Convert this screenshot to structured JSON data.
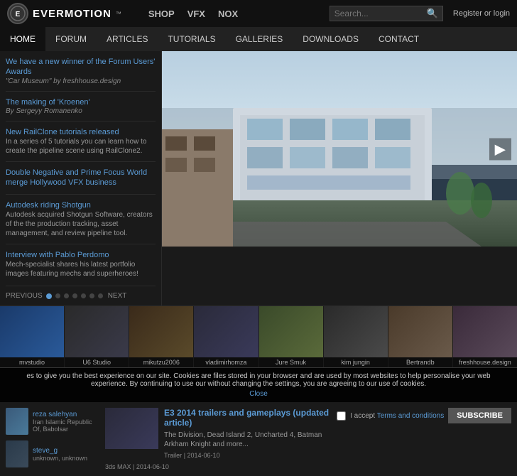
{
  "logo": {
    "icon": "E",
    "brand": "EVERMOTION",
    "tm": "™"
  },
  "topnav": {
    "items": [
      "SHOP",
      "VFX",
      "NOX"
    ],
    "search_placeholder": "Search...",
    "auth": "Register or login"
  },
  "mainnav": {
    "items": [
      "HOME",
      "FORUM",
      "ARTICLES",
      "TUTORIALS",
      "GALLERIES",
      "DOWNLOADS",
      "CONTACT"
    ],
    "active": "HOME"
  },
  "sidebar": {
    "news": [
      {
        "title": "We have a new winner of the Forum Users' Awards",
        "sub": "\"Car Museum\" by freshhouse.design",
        "desc": ""
      },
      {
        "title": "The making of 'Kroenen'",
        "sub": "By Sergeyy Romanenko",
        "desc": ""
      },
      {
        "title": "New RailClone tutorials released",
        "sub": "",
        "desc": "In a series of 5 tutorials you can learn how to create the pipeline scene using RailClone2."
      },
      {
        "title": "Double Negative and Prime Focus World merge Hollywood VFX business",
        "sub": "",
        "desc": ""
      },
      {
        "title": "Autodesk riding Shotgun",
        "sub": "",
        "desc": "Autodesk acquired Shotgun Software, creators of the the production tracking, asset management, and review pipeline tool."
      },
      {
        "title": "Interview with Pablo Perdomo",
        "sub": "",
        "desc": "Mech-specialist shares his latest portfolio images featuring mechs and superheroes!"
      }
    ],
    "prev": "PREVIOUS",
    "next": "NEXT",
    "dots": 7
  },
  "thumbs": [
    {
      "label": "mvstudio",
      "color": "t1"
    },
    {
      "label": "U6 Studio",
      "color": "t2"
    },
    {
      "label": "mikutzu2006",
      "color": "t3"
    },
    {
      "label": "vladimirhomza",
      "color": "t4"
    },
    {
      "label": "Jure Smuk",
      "color": "t5"
    },
    {
      "label": "kim jungin",
      "color": "t6"
    },
    {
      "label": "Bertrandb",
      "color": "t7"
    },
    {
      "label": "freshhouse.design",
      "color": "t8"
    }
  ],
  "cookie": {
    "text": "es to give you the best experience on our site. Cookies are files stored in your browser and are used by most websites to help personalise your web experience. By continuing to use our without changing the settings, you are agreeing to our use of cookies.",
    "close": "Close"
  },
  "bottom": {
    "users": [
      {
        "name": "reza salehyan",
        "loc": "Iran Islamic Republic Of, Babolsar"
      },
      {
        "name": "steve_g",
        "loc": "unknown, unknown"
      }
    ],
    "article": {
      "title": "E3 2014 trailers and gameplays (updated article)",
      "desc": "The Division, Dead Island 2, Uncharted 4, Batman Arkham Knight and more...",
      "tag": "Trailer",
      "date": "2014-06-10"
    },
    "subscribe": {
      "checkbox_label": "I accept Terms and conditions",
      "button": "SUBSCRIBE",
      "terms_link": "Terms and conditions"
    },
    "note": "3ds MAX  |  2014-06-10"
  }
}
